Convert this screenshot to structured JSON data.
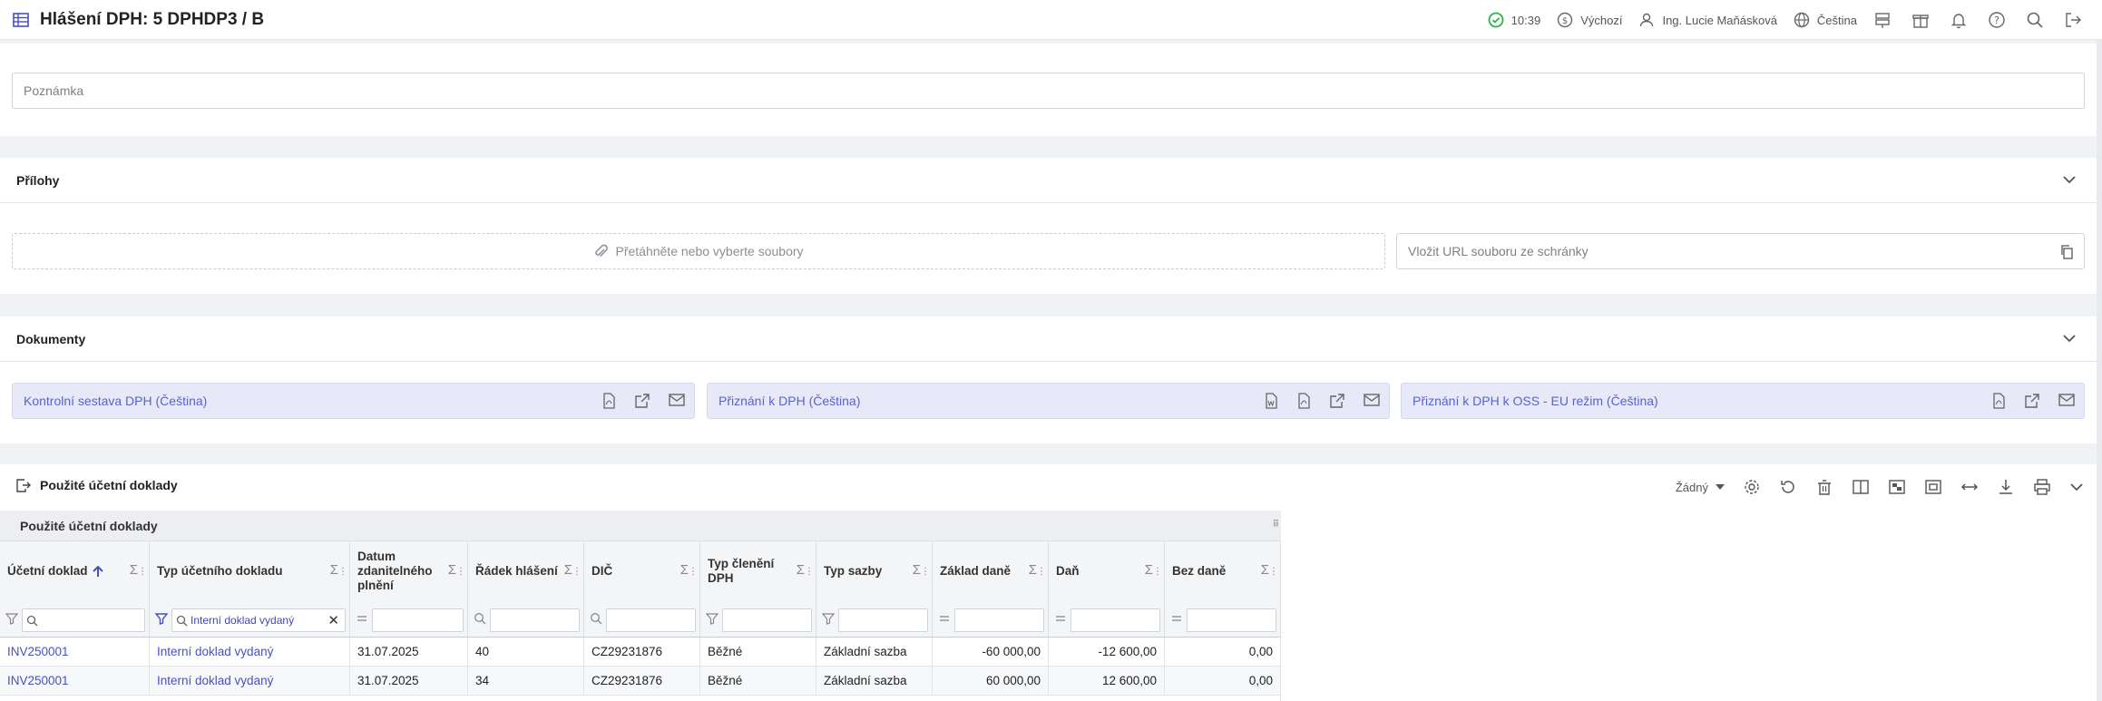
{
  "header": {
    "title": "Hlášení DPH: 5 DPHDP3 / B",
    "time": "10:39",
    "currency": "Výchozí",
    "user": "Ing. Lucie Maňásková",
    "language": "Čeština"
  },
  "note": {
    "placeholder": "Poznámka"
  },
  "attachments": {
    "title": "Přílohy",
    "dropzone_label": "Přetáhněte nebo vyberte soubory",
    "url_placeholder": "Vložit URL souboru ze schránky"
  },
  "documents": {
    "title": "Dokumenty",
    "items": [
      {
        "label": "Kontrolní sestava DPH (Čeština)"
      },
      {
        "label": "Přiznání k DPH (Čeština)"
      },
      {
        "label": "Přiznání k DPH k OSS - EU režim (Čeština)"
      }
    ]
  },
  "used_docs": {
    "title": "Použité účetní doklady",
    "view_select": "Žádný",
    "grid_title": "Použité účetní doklady",
    "columns": [
      {
        "label": "Účetní doklad"
      },
      {
        "label": "Typ účetního dokladu"
      },
      {
        "label": "Datum zdanitelného plnění"
      },
      {
        "label": "Řádek hlášení"
      },
      {
        "label": "DIČ"
      },
      {
        "label": "Typ členění DPH"
      },
      {
        "label": "Typ sazby"
      },
      {
        "label": "Základ daně"
      },
      {
        "label": "Daň"
      },
      {
        "label": "Bez daně"
      }
    ],
    "type_filter_value": "Interní doklad vydaný",
    "rows": [
      [
        "INV250001",
        "Interní doklad vydaný",
        "31.07.2025",
        "40",
        "CZ29231876",
        "Běžné",
        "Základní sazba",
        "-60 000,00",
        "-12 600,00",
        "0,00"
      ],
      [
        "INV250001",
        "Interní doklad vydaný",
        "31.07.2025",
        "34",
        "CZ29231876",
        "Běžné",
        "Základní sazba",
        "60 000,00",
        "12 600,00",
        "0,00"
      ]
    ]
  },
  "colors": {
    "accent": "#4651c0",
    "doc_button_bg": "#e7e9f8",
    "status_ok": "#2db34a"
  }
}
